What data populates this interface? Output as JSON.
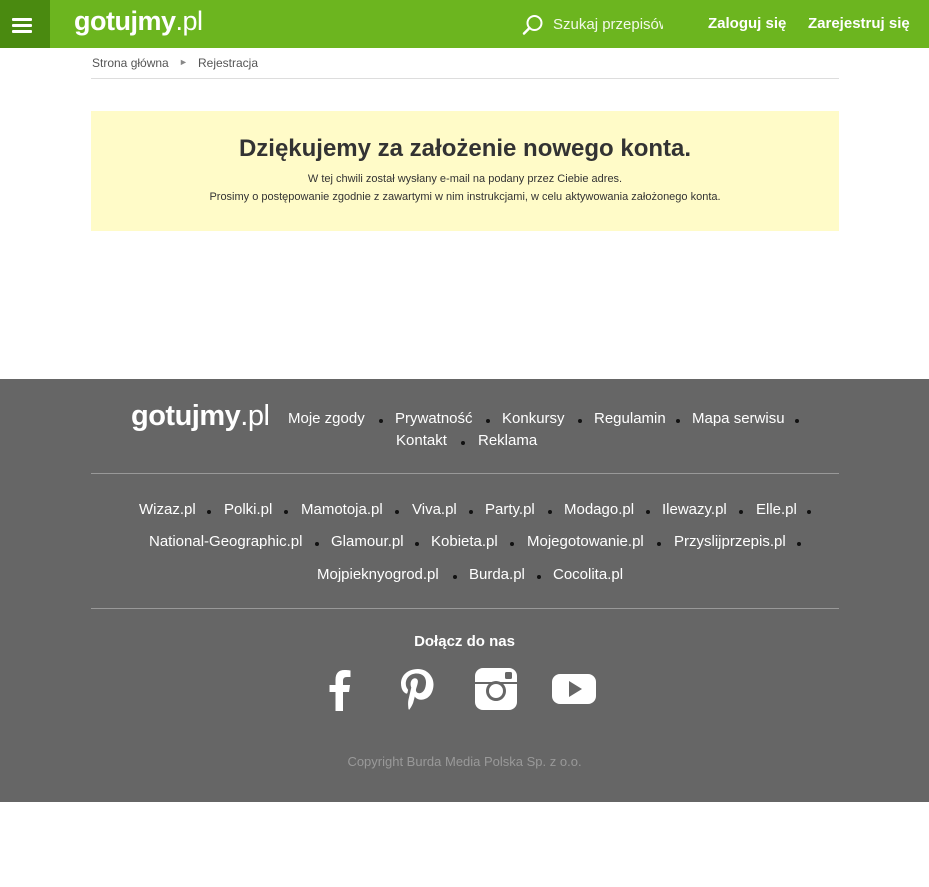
{
  "header": {
    "logo_bold": "gotujmy",
    "logo_light": ".pl",
    "search_placeholder": "Szukaj przepisów",
    "login_label": "Zaloguj się",
    "register_label": "Zarejestruj się",
    "brand_color": "#6cb51f"
  },
  "breadcrumb": {
    "home": "Strona główna",
    "separator": "►",
    "current": "Rejestracja"
  },
  "notice": {
    "title": "Dziękujemy za założenie nowego konta.",
    "line1": "W tej chwili został wysłany e-mail na podany przez Ciebie adres.",
    "line2": "Prosimy o postępowanie zgodnie z zawartymi w nim instrukcjami, w celu aktywowania założonego konta.",
    "bg_color": "#fffbc8"
  },
  "footer": {
    "logo_bold": "gotujmy",
    "logo_light": ".pl",
    "nav": [
      "Moje zgody",
      "Prywatność",
      "Konkursy",
      "Regulamin",
      "Mapa serwisu",
      "Kontakt",
      "Reklama"
    ],
    "sites": [
      "Wizaz.pl",
      "Polki.pl",
      "Mamotoja.pl",
      "Viva.pl",
      "Party.pl",
      "Modago.pl",
      "Ilewazy.pl",
      "Elle.pl",
      "National-Geographic.pl",
      "Glamour.pl",
      "Kobieta.pl",
      "Mojegotowanie.pl",
      "Przyslijprzepis.pl",
      "Mojpieknyogrod.pl",
      "Burda.pl",
      "Cocolita.pl"
    ],
    "join_label": "Dołącz do nas",
    "social": [
      "facebook-icon",
      "pinterest-icon",
      "instagram-icon",
      "youtube-icon"
    ],
    "copyright": "Copyright Burda Media Polska Sp. z o.o.",
    "bg_color": "#666666"
  }
}
